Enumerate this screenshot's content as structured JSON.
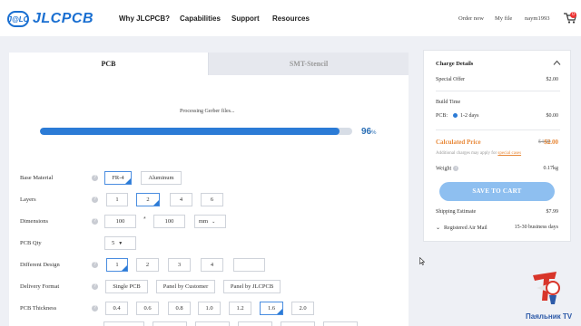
{
  "header": {
    "logo_badge": "J@LC",
    "logo_text": "JLCPCB",
    "nav": [
      "Why JLCPCB?",
      "Capabilities",
      "Support",
      "Resources"
    ],
    "order_now": "Order now",
    "my_file": "My file",
    "username": "naym1993",
    "cart_count": "0"
  },
  "tabs": {
    "pcb": "PCB",
    "smt": "SMT-Stencil"
  },
  "progress": {
    "label": "Processing Gerber files...",
    "percent": 96,
    "percent_text": "96",
    "percent_sign": "%"
  },
  "form": {
    "base_material": {
      "label": "Base Material",
      "options": [
        "FR-4",
        "Aluminum"
      ],
      "selected": "FR-4"
    },
    "layers": {
      "label": "Layers",
      "options": [
        "1",
        "2",
        "4",
        "6"
      ],
      "selected": "2"
    },
    "dimensions": {
      "label": "Dimensions",
      "width": "100",
      "times": "*",
      "height": "100",
      "unit": "mm"
    },
    "pcb_qty": {
      "label": "PCB Qty",
      "value": "5"
    },
    "different_design": {
      "label": "Different Design",
      "options": [
        "1",
        "2",
        "3",
        "4",
        ""
      ],
      "selected": "1"
    },
    "delivery_format": {
      "label": "Delivery Format",
      "options": [
        "Single PCB",
        "Panel by Customer",
        "Panel by JLCPCB"
      ],
      "selected": "Single PCB"
    },
    "pcb_thickness": {
      "label": "PCB Thickness",
      "options": [
        "0.4",
        "0.6",
        "0.8",
        "1.0",
        "1.2",
        "1.6",
        "2.0"
      ],
      "selected": "1.6"
    }
  },
  "charges": {
    "title": "Charge Details",
    "special_offer_label": "Special Offer",
    "special_offer_value": "$2.00",
    "build_time_label": "Build Time",
    "pcb_label": "PCB:",
    "pcb_days": "1-2 days",
    "pcb_value": "$0.00",
    "calculated_label": "Calculated Price",
    "old_price": "$4.00",
    "new_price": "$2.00",
    "note_prefix": "Additional charges may apply for",
    "note_link": "special cases",
    "weight_label": "Weight",
    "weight_value": "0.17kg",
    "save_button": "SAVE TO CART",
    "shipping_label": "Shipping Estimate",
    "shipping_value": "$7.99",
    "shipping_method": "Registered Air Mail",
    "shipping_days": "15-30 business days"
  },
  "watermark": "Паяльник TV",
  "colors": {
    "brand_blue": "#1a6fd1",
    "progress": "#2b7bd6",
    "accent_orange": "#e8893a",
    "button_disabled": "#8ebff0"
  }
}
